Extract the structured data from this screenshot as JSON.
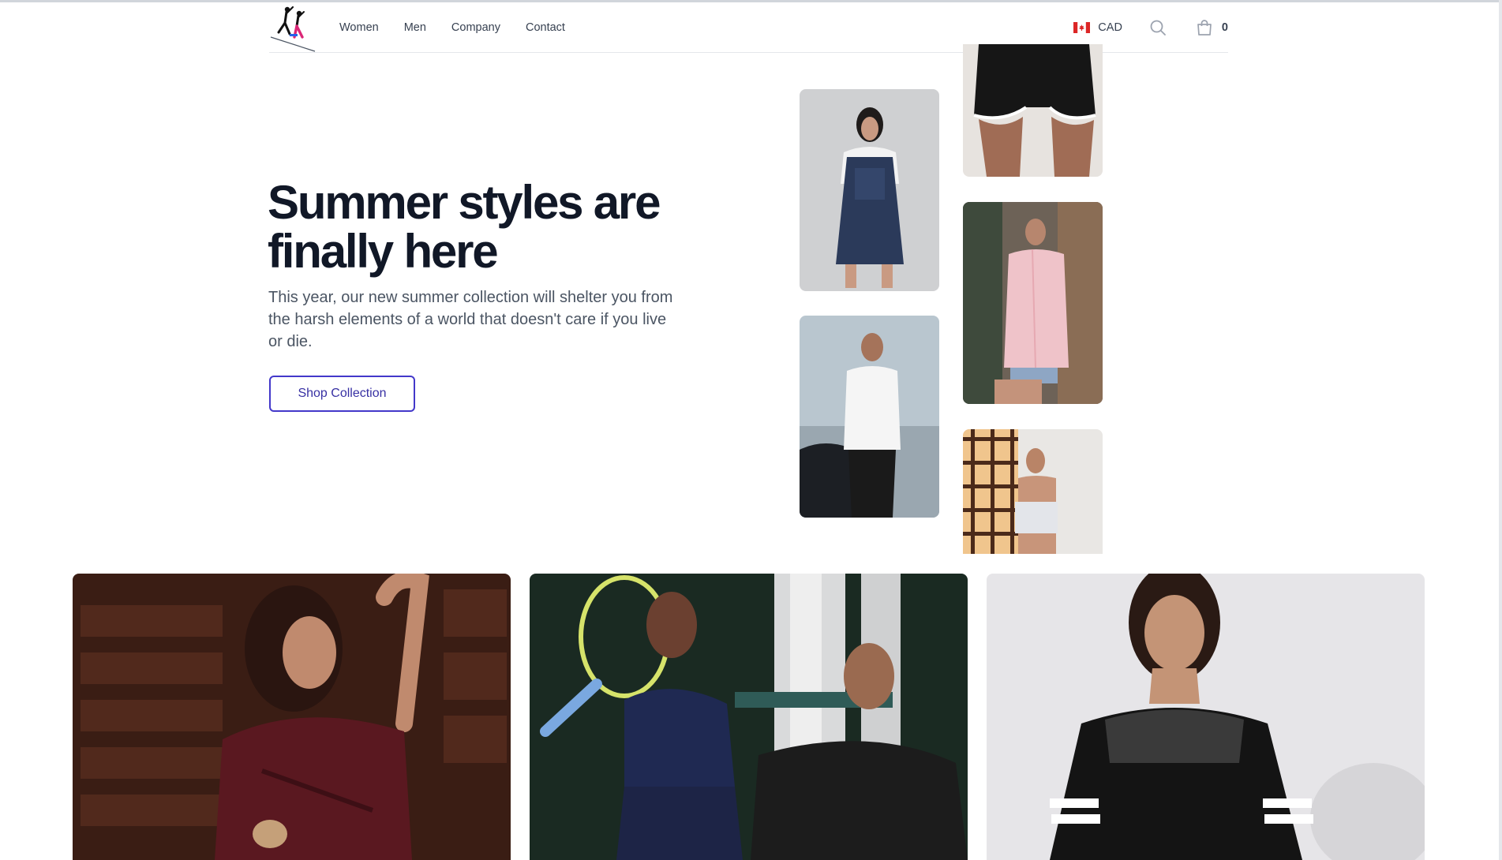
{
  "nav": {
    "links": [
      {
        "label": "Women"
      },
      {
        "label": "Men"
      },
      {
        "label": "Company"
      },
      {
        "label": "Contact"
      }
    ],
    "currency": {
      "code": "CAD",
      "flag_icon": "canada-flag-icon"
    },
    "search_icon": "search-icon",
    "cart": {
      "icon": "shopping-bag-icon",
      "count": "0"
    }
  },
  "hero": {
    "title": "Summer styles are finally here",
    "description": "This year, our new summer collection will shelter you from the harsh elements of a world that doesn't care if you live or die.",
    "cta_label": "Shop Collection"
  },
  "colors": {
    "accent": "#4338ca",
    "heading": "#111827",
    "body_text": "#4b5563"
  }
}
